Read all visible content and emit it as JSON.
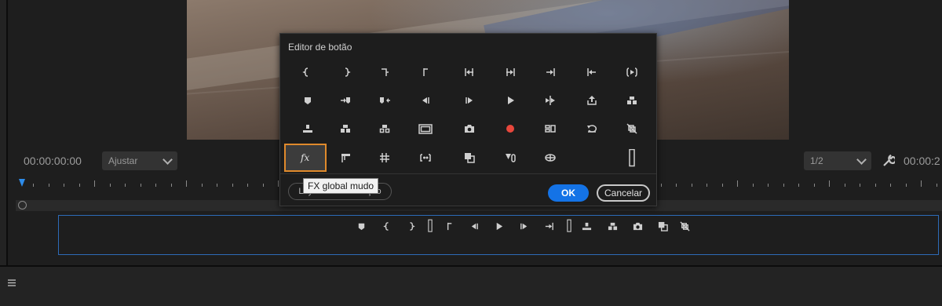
{
  "monitor": {
    "timecode_left": "00:00:00:00",
    "fit_dropdown": "Ajustar",
    "resolution_dropdown": "1/2",
    "timecode_right": "00:00:2"
  },
  "dialog": {
    "title": "Editor de botão",
    "reset_label": "Layout de redefinição",
    "ok_label": "OK",
    "cancel_label": "Cancelar",
    "tooltip": "FX global mudo",
    "rows": [
      [
        "mark-in-icon",
        "mark-out-icon",
        "mark-clip-icon",
        "go-to-in-icon",
        "go-to-prev-edit-icon",
        "go-to-next-edit-icon",
        "go-to-out-icon",
        "step-back-icon",
        "play-in-to-out-icon"
      ],
      [
        "add-marker-icon",
        "go-to-next-marker-icon",
        "go-to-prev-marker-icon",
        "step-back-frame-icon",
        "step-forward-frame-icon",
        "play-icon",
        "play-around-icon",
        "export-frame-icon",
        "lift-icon"
      ],
      [
        "insert-icon",
        "overwrite-icon",
        "extract-icon",
        "safe-margins-icon",
        "camera-icon",
        "record-icon",
        "multi-camera-icon",
        "loop-icon",
        "toggle-proxies-icon"
      ],
      [
        "fx-global-mute-icon",
        "trim-icon",
        "grid-icon",
        "vr-video-icon",
        "compare-view-icon",
        "toggle-link-icon",
        "comparison-icon",
        "",
        "spacer-icon"
      ]
    ]
  },
  "button_bar": {
    "buttons": [
      "add-marker-icon",
      "mark-in-icon",
      "mark-out-icon",
      "spacer-icon",
      "go-to-in-icon",
      "step-back-frame-icon",
      "play-icon",
      "step-forward-frame-icon",
      "go-to-out-icon",
      "spacer-icon",
      "insert-icon",
      "overwrite-icon",
      "camera-icon",
      "compare-view-icon",
      "toggle-proxies-icon"
    ]
  },
  "colors": {
    "accent": "#1473e6",
    "highlight": "#e08a2c",
    "record": "#e8473c"
  }
}
